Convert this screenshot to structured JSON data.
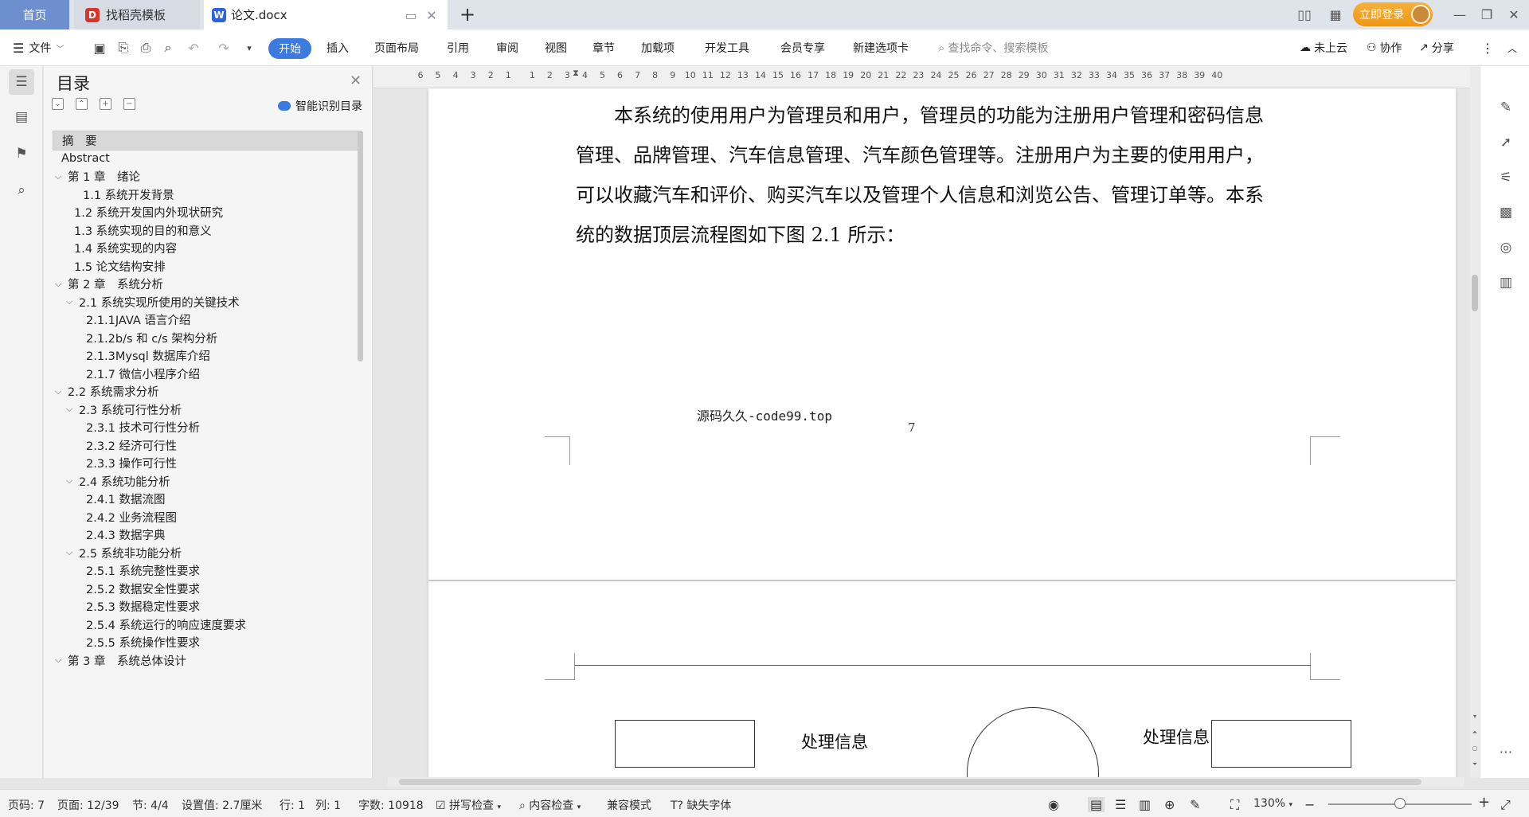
{
  "tabs": {
    "home": "首页",
    "template": "找稻壳模板",
    "doc": "论文.docx",
    "login": "立即登录"
  },
  "ribbon": {
    "file": "文件",
    "tabs": [
      "开始",
      "插入",
      "页面布局",
      "引用",
      "审阅",
      "视图",
      "章节",
      "加载项",
      "开发工具",
      "会员专享",
      "新建选项卡"
    ],
    "search_placeholder": "查找命令、搜索模板",
    "cloud": "未上云",
    "collab": "协作",
    "share": "分享"
  },
  "toc": {
    "title": "目录",
    "smart": "智能识别目录",
    "items": [
      {
        "text": "摘　要",
        "level": 0,
        "caret": false,
        "active": true
      },
      {
        "text": "Abstract",
        "level": 0,
        "caret": false
      },
      {
        "text": "第 1 章　绪论",
        "level": 0,
        "caret": true
      },
      {
        "text": "1.1 系统开发背景",
        "level": 2,
        "caret": false
      },
      {
        "text": "1.2 系统开发国内外现状研究",
        "level": 1,
        "caret": false
      },
      {
        "text": "1.3 系统实现的目的和意义",
        "level": 1,
        "caret": false
      },
      {
        "text": "1.4 系统实现的内容",
        "level": 1,
        "caret": false
      },
      {
        "text": "1.5 论文结构安排",
        "level": 1,
        "caret": false
      },
      {
        "text": "第 2 章　系统分析",
        "level": 0,
        "caret": true
      },
      {
        "text": "2.1 系统实现所使用的关键技术",
        "level": 1,
        "caret": true
      },
      {
        "text": "2.1.1JAVA 语言介绍",
        "level": 2,
        "caret": false
      },
      {
        "text": "2.1.2b/s 和 c/s 架构分析",
        "level": 2,
        "caret": false
      },
      {
        "text": "2.1.3Mysql 数据库介绍",
        "level": 2,
        "caret": false
      },
      {
        "text": "2.1.7 微信小程序介绍",
        "level": 2,
        "caret": false
      },
      {
        "text": "2.2 系统需求分析",
        "level": 0,
        "caret": true
      },
      {
        "text": "2.3 系统可行性分析",
        "level": 1,
        "caret": true
      },
      {
        "text": "2.3.1 技术可行性分析",
        "level": 2,
        "caret": false
      },
      {
        "text": "2.3.2 经济可行性",
        "level": 2,
        "caret": false
      },
      {
        "text": "2.3.3 操作可行性",
        "level": 2,
        "caret": false
      },
      {
        "text": "2.4 系统功能分析",
        "level": 1,
        "caret": true
      },
      {
        "text": "2.4.1 数据流图",
        "level": 2,
        "caret": false
      },
      {
        "text": "2.4.2  业务流程图",
        "level": 2,
        "caret": false
      },
      {
        "text": "2.4.3 数据字典",
        "level": 2,
        "caret": false
      },
      {
        "text": "2.5  系统非功能分析",
        "level": 1,
        "caret": true
      },
      {
        "text": "2.5.1 系统完整性要求",
        "level": 2,
        "caret": false
      },
      {
        "text": "2.5.2 数据安全性要求",
        "level": 2,
        "caret": false
      },
      {
        "text": "2.5.3 数据稳定性要求",
        "level": 2,
        "caret": false
      },
      {
        "text": "2.5.4 系统运行的响应速度要求",
        "level": 2,
        "caret": false
      },
      {
        "text": "2.5.5 系统操作性要求",
        "level": 2,
        "caret": false
      },
      {
        "text": "第 3 章　系统总体设计",
        "level": 0,
        "caret": true
      }
    ]
  },
  "ruler": [
    "6",
    "5",
    "4",
    "3",
    "2",
    "1",
    "1",
    "2",
    "3",
    "4",
    "5",
    "6",
    "7",
    "8",
    "9",
    "10",
    "11",
    "12",
    "13",
    "14",
    "15",
    "16",
    "17",
    "18",
    "19",
    "20",
    "21",
    "22",
    "23",
    "24",
    "25",
    "26",
    "27",
    "28",
    "29",
    "30",
    "31",
    "32",
    "33",
    "34",
    "35",
    "36",
    "37",
    "38",
    "39",
    "40"
  ],
  "document": {
    "paragraph_lines": [
      "　　本系统的使用用户为管理员和用户，管理员的功能为注册用户管理和密码信息",
      "管理、品牌管理、汽车信息管理、汽车颜色管理等。注册用户为主要的使用用户，",
      "可以收藏汽车和评价、购买汽车以及管理个人信息和浏览公告、管理订单等。本系",
      "统的数据顶层流程图如下图 2.1 所示："
    ],
    "footer_source": "源码久久-code99.top",
    "page_number": "7",
    "flow_label_left": "处理信息",
    "flow_label_right": "处理信息"
  },
  "status": {
    "page_code": "页码: 7",
    "page": "页面: 12/39",
    "section": "节: 4/4",
    "setting": "设置值: 2.7厘米",
    "row": "行: 1",
    "col": "列: 1",
    "words": "字数: 10918",
    "spell": "拼写检查",
    "content_check": "内容检查",
    "compat": "兼容模式",
    "missing_font": "缺失字体",
    "zoom": "130%"
  }
}
